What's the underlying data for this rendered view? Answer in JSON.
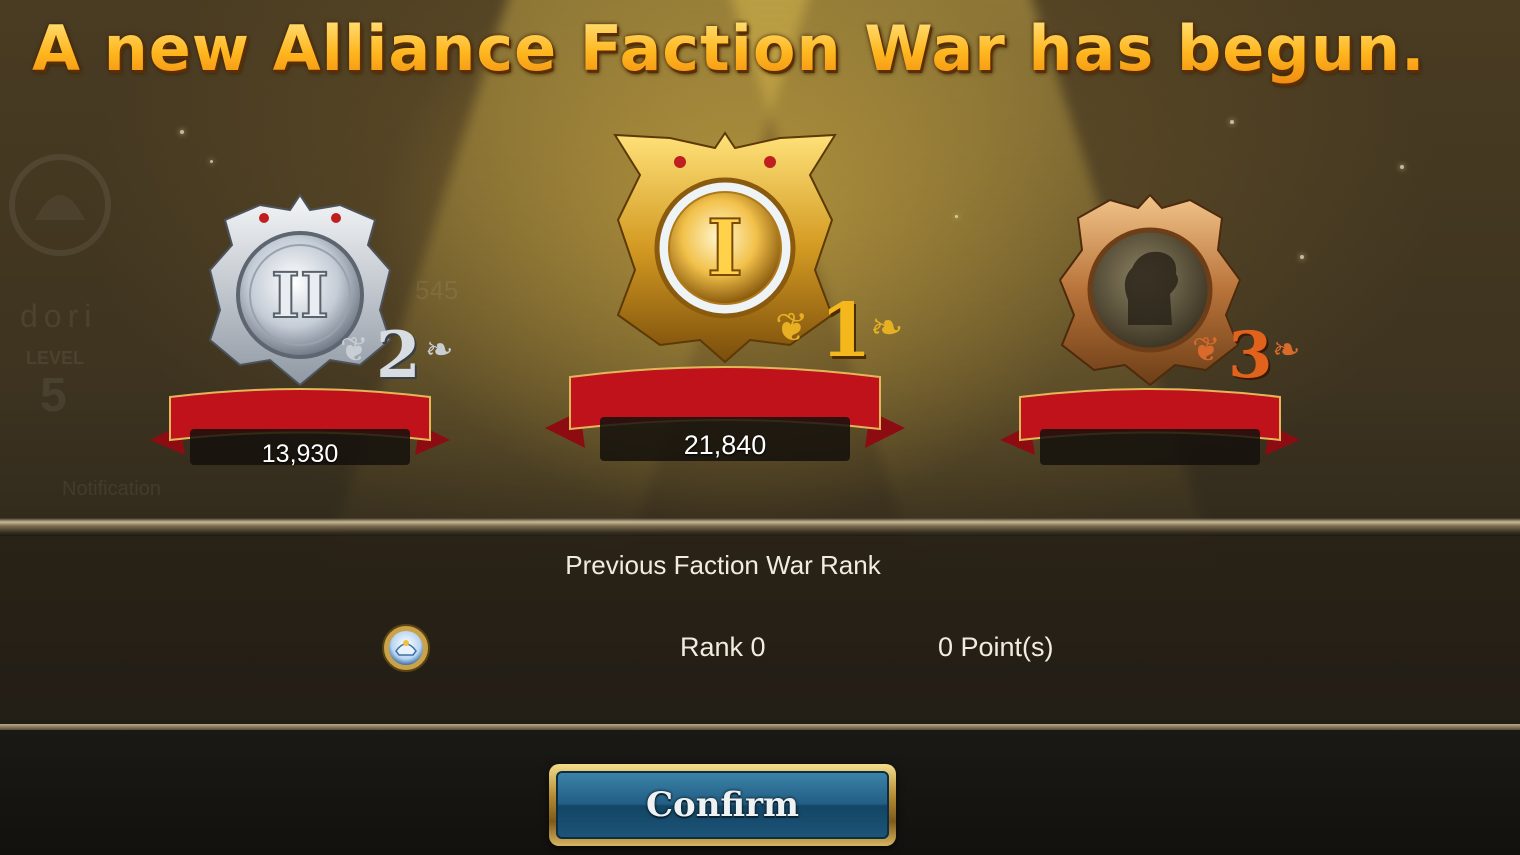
{
  "headline": "A new Alliance Faction War has begun.",
  "background": {
    "player_name": "dori",
    "level_label": "LEVEL",
    "level_value": "5",
    "value": "545",
    "notification_label": "Notification"
  },
  "podium": [
    {
      "place": "2",
      "medal_numeral": "II",
      "score": "13,930",
      "medal": "silver",
      "color": "#d8dde3"
    },
    {
      "place": "1",
      "medal_numeral": "I",
      "score": "21,840",
      "medal": "gold",
      "color": "#f4b81c"
    },
    {
      "place": "3",
      "medal_numeral": "",
      "score": "",
      "medal": "bronze",
      "color": "#e0621c"
    }
  ],
  "previous": {
    "title": "Previous Faction War Rank",
    "rank": "Rank 0",
    "points": "0 Point(s)",
    "badge_icon": "alliance-crest-icon"
  },
  "confirm_label": "Confirm",
  "colors": {
    "headline": "#ffc22a",
    "ribbon": "#c0121b",
    "button": "#235e84",
    "button_frame": "#c9a24a"
  }
}
